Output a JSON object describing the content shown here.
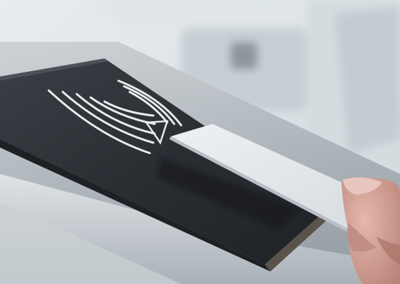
{
  "scene": {
    "description_visible_text": "",
    "colors": {
      "background_light": "#e7ecef",
      "background_mid": "#cfd7dc",
      "metal_light": "#d9dde0",
      "metal_mid": "#b9c0c5",
      "metal_dark": "#8f989e",
      "reader_panel": "#2c3035",
      "reader_panel_edge": "#1d2024",
      "nfc_symbol": "#e9ecef",
      "card": "#e6eaee",
      "card_shadow": "#b8c0c6",
      "skin": "#d8a99d",
      "skin_shadow": "#b8837a",
      "nail": "#e8c5bd"
    },
    "icons": {
      "contactless": "contactless-waves-icon"
    }
  }
}
